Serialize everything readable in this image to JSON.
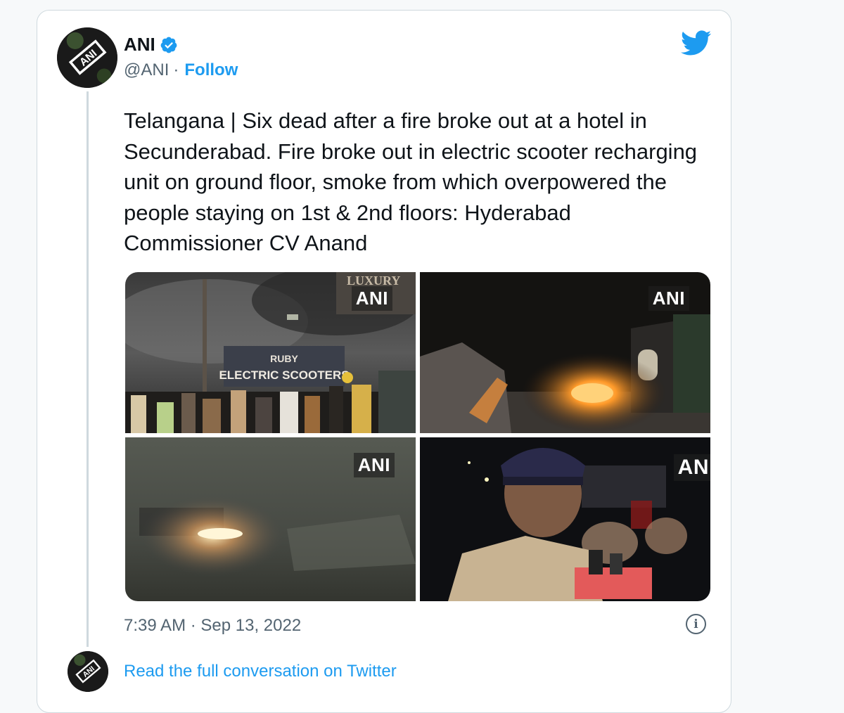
{
  "tweet": {
    "author": {
      "name": "ANI",
      "handle": "@ANI",
      "follow_label": "Follow",
      "separator": "·",
      "avatar_logo": "ANI",
      "verified_icon": "verified-badge-icon"
    },
    "text": "Telangana | Six dead after a fire broke out at a hotel in Secunderabad. Fire broke out in electric scooter recharging unit on ground floor, smoke from which overpowered the people staying on 1st & 2nd floors: Hyderabad Commissioner CV Anand",
    "media": [
      {
        "watermark": "ANI",
        "sign_text_1": "RUBY",
        "sign_text_2": "ELECTRIC SCOOTERS",
        "top_sign": "LUXURY"
      },
      {
        "watermark": "ANI"
      },
      {
        "watermark": "ANI"
      },
      {
        "watermark": "AN"
      }
    ],
    "timestamp": "7:39 AM · Sep 13, 2022",
    "info_icon_glyph": "i",
    "read_more": "Read the full conversation on Twitter"
  },
  "colors": {
    "accent": "#1d9bf0",
    "text": "#0f1419",
    "secondary": "#536471",
    "border": "#cfd9de"
  }
}
